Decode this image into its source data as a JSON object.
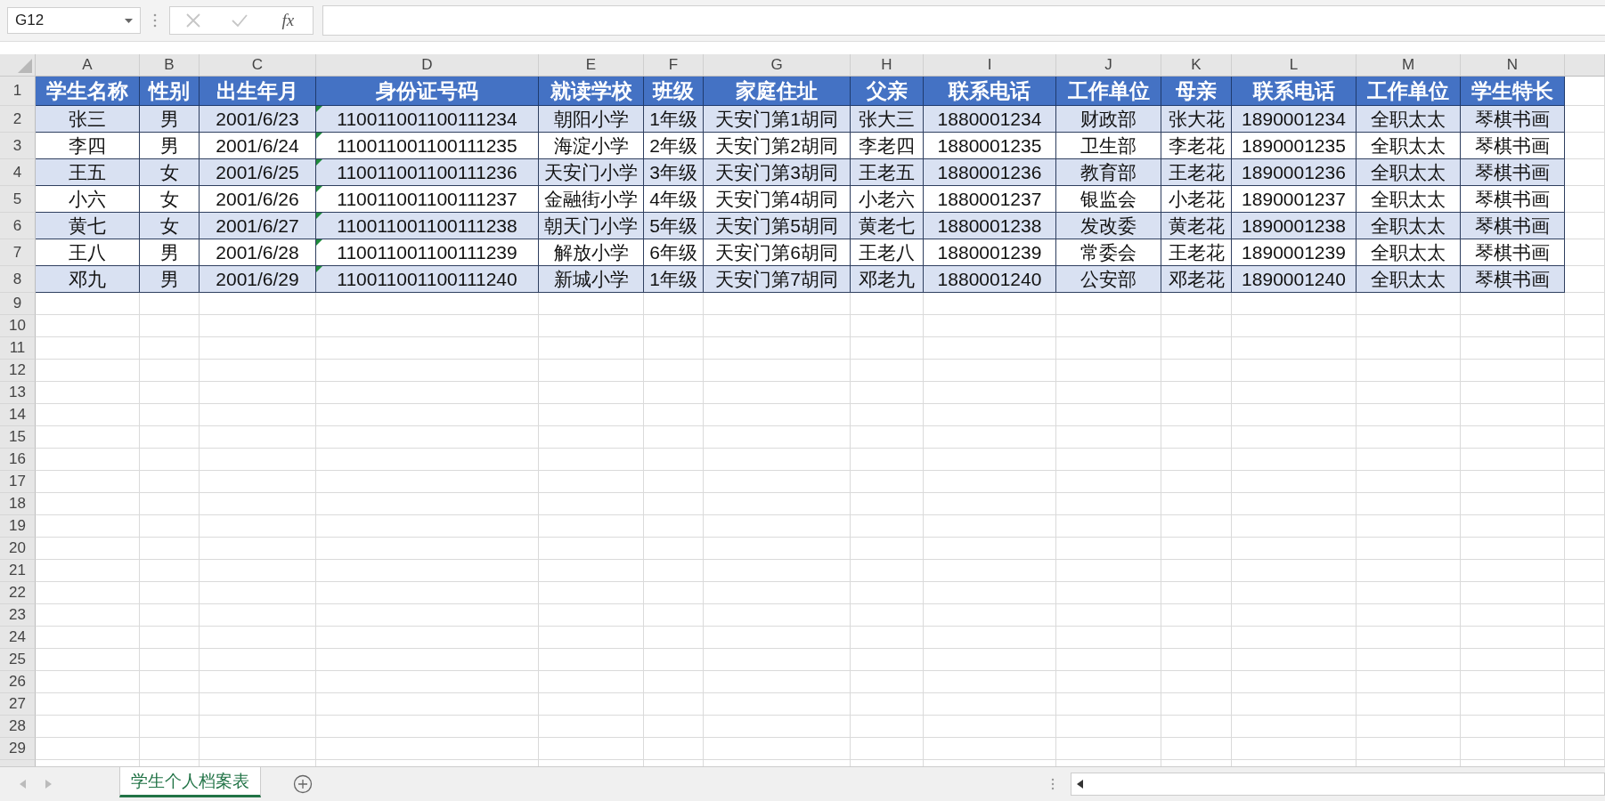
{
  "name_box": {
    "value": "G12"
  },
  "formula_bar": {
    "function_label": "fx"
  },
  "column_headers": [
    "A",
    "B",
    "C",
    "D",
    "E",
    "F",
    "G",
    "H",
    "I",
    "J",
    "K",
    "L",
    "M",
    "N"
  ],
  "table": {
    "columns": [
      {
        "label": "学生名称",
        "text_number_flag": false
      },
      {
        "label": "性别",
        "text_number_flag": false
      },
      {
        "label": "出生年月",
        "text_number_flag": false
      },
      {
        "label": "身份证号码",
        "text_number_flag": true
      },
      {
        "label": "就读学校",
        "text_number_flag": false
      },
      {
        "label": "班级",
        "text_number_flag": false
      },
      {
        "label": "家庭住址",
        "text_number_flag": false
      },
      {
        "label": "父亲",
        "text_number_flag": false
      },
      {
        "label": "联系电话",
        "text_number_flag": false
      },
      {
        "label": "工作单位",
        "text_number_flag": false
      },
      {
        "label": "母亲",
        "text_number_flag": false
      },
      {
        "label": "联系电话",
        "text_number_flag": false
      },
      {
        "label": "工作单位",
        "text_number_flag": false
      },
      {
        "label": "学生特长",
        "text_number_flag": false
      }
    ],
    "rows": [
      [
        "张三",
        "男",
        "2001/6/23",
        "110011001100111234",
        "朝阳小学",
        "1年级",
        "天安门第1胡同",
        "张大三",
        "1880001234",
        "财政部",
        "张大花",
        "1890001234",
        "全职太太",
        "琴棋书画"
      ],
      [
        "李四",
        "男",
        "2001/6/24",
        "110011001100111235",
        "海淀小学",
        "2年级",
        "天安门第2胡同",
        "李老四",
        "1880001235",
        "卫生部",
        "李老花",
        "1890001235",
        "全职太太",
        "琴棋书画"
      ],
      [
        "王五",
        "女",
        "2001/6/25",
        "110011001100111236",
        "天安门小学",
        "3年级",
        "天安门第3胡同",
        "王老五",
        "1880001236",
        "教育部",
        "王老花",
        "1890001236",
        "全职太太",
        "琴棋书画"
      ],
      [
        "小六",
        "女",
        "2001/6/26",
        "110011001100111237",
        "金融街小学",
        "4年级",
        "天安门第4胡同",
        "小老六",
        "1880001237",
        "银监会",
        "小老花",
        "1890001237",
        "全职太太",
        "琴棋书画"
      ],
      [
        "黄七",
        "女",
        "2001/6/27",
        "110011001100111238",
        "朝天门小学",
        "5年级",
        "天安门第5胡同",
        "黄老七",
        "1880001238",
        "发改委",
        "黄老花",
        "1890001238",
        "全职太太",
        "琴棋书画"
      ],
      [
        "王八",
        "男",
        "2001/6/28",
        "110011001100111239",
        "解放小学",
        "6年级",
        "天安门第6胡同",
        "王老八",
        "1880001239",
        "常委会",
        "王老花",
        "1890001239",
        "全职太太",
        "琴棋书画"
      ],
      [
        "邓九",
        "男",
        "2001/6/29",
        "110011001100111240",
        "新城小学",
        "1年级",
        "天安门第7胡同",
        "邓老九",
        "1880001240",
        "公安部",
        "邓老花",
        "1890001240",
        "全职太太",
        "琴棋书画"
      ]
    ]
  },
  "row_numbers": [
    "1",
    "2",
    "3",
    "4",
    "5",
    "6",
    "7",
    "8",
    "9",
    "10",
    "11",
    "12",
    "13",
    "14",
    "15",
    "16",
    "17",
    "18",
    "19",
    "20",
    "21",
    "22",
    "23",
    "24",
    "25",
    "26",
    "27",
    "28",
    "29"
  ],
  "sheet_tabs": [
    {
      "label": "学生个人档案表",
      "selected": true
    }
  ]
}
